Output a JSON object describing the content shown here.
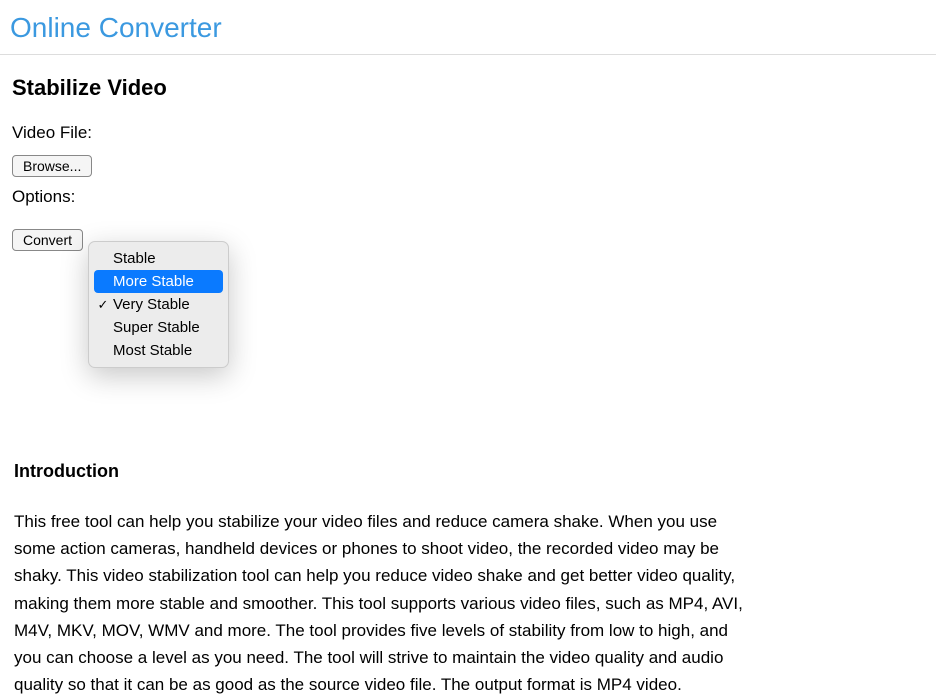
{
  "header": {
    "title": "Online Converter"
  },
  "page": {
    "title": "Stabilize Video"
  },
  "form": {
    "video_file_label": "Video File:",
    "browse_button": "Browse...",
    "options_label": "Options:",
    "convert_button": "Convert"
  },
  "dropdown": {
    "items": [
      {
        "label": "Stable",
        "checked": false,
        "highlighted": false
      },
      {
        "label": "More Stable",
        "checked": false,
        "highlighted": true
      },
      {
        "label": "Very Stable",
        "checked": true,
        "highlighted": false
      },
      {
        "label": "Super Stable",
        "checked": false,
        "highlighted": false
      },
      {
        "label": "Most Stable",
        "checked": false,
        "highlighted": false
      }
    ]
  },
  "intro": {
    "title": "Introduction",
    "text": "This free tool can help you stabilize your video files and reduce camera shake. When you use some action cameras, handheld devices or phones to shoot video, the recorded video may be shaky. This video stabilization tool can help you reduce video shake and get better video quality, making them more stable and smoother. This tool supports various video files, such as MP4, AVI, M4V, MKV, MOV, WMV and more. The tool provides five levels of stability from low to high, and you can choose a level as you need. The tool will strive to maintain the video quality and audio quality so that it can be as good as the source video file. The output format is MP4 video."
  }
}
